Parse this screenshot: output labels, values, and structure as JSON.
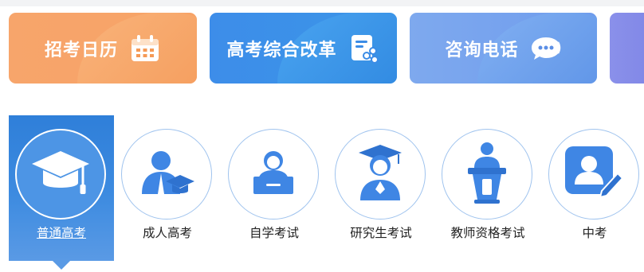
{
  "quick_links": [
    {
      "label": "招考日历",
      "icon": "calendar-icon"
    },
    {
      "label": "高考综合改革",
      "icon": "document-share-icon"
    },
    {
      "label": "咨询电话",
      "icon": "chat-bubble-icon"
    },
    {
      "label": "",
      "icon": ""
    }
  ],
  "categories": [
    {
      "label": "普通高考",
      "icon": "graduation-cap-icon",
      "active": true
    },
    {
      "label": "成人高考",
      "icon": "adult-graduate-icon",
      "active": false
    },
    {
      "label": "自学考试",
      "icon": "laptop-student-icon",
      "active": false
    },
    {
      "label": "研究生考试",
      "icon": "graduate-student-icon",
      "active": false
    },
    {
      "label": "教师资格考试",
      "icon": "teacher-podium-icon",
      "active": false
    },
    {
      "label": "中考",
      "icon": "student-card-icon",
      "active": false
    }
  ],
  "colors": {
    "orange_card": "#f7a56b",
    "blue_card": "#3d8de9",
    "lightblue_card": "#7ea9ee",
    "purple_card": "#8a90ea",
    "active_tab": "#3d8be0",
    "icon_blue": "#3f86e4"
  }
}
